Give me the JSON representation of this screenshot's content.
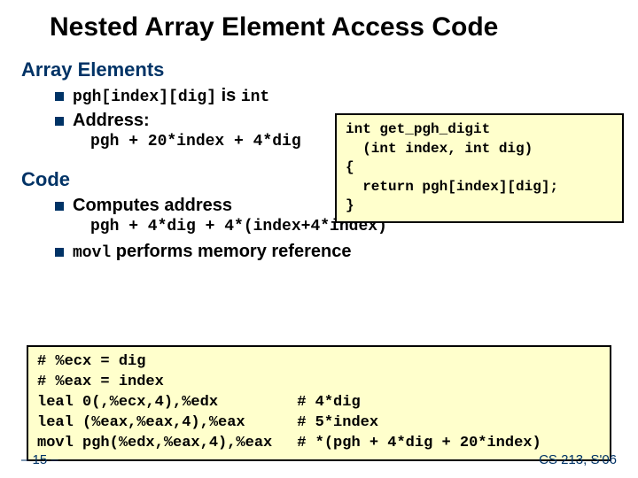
{
  "title": "Nested Array Element Access Code",
  "section1": "Array Elements",
  "b1a": "pgh[index][dig]",
  "b1b": " is ",
  "b1c": "int",
  "b2": "Address:",
  "addr_expr": "pgh + 20*index + 4*dig",
  "section2": "Code",
  "b3": "Computes address",
  "comp_expr": "pgh + 4*dig + 4*(index+4*index)",
  "b4a": "movl",
  "b4b": " performs memory reference",
  "code_get": "int get_pgh_digit\n  (int index, int dig)\n{\n  return pgh[index][dig];\n}",
  "asm_left": "# %ecx = dig\n# %eax = index\nleal 0(,%ecx,4),%edx\nleal (%eax,%eax,4),%eax\nmovl pgh(%edx,%eax,4),%eax",
  "asm_right": "\n\n# 4*dig\n# 5*index\n# *(pgh + 4*dig + 20*index)",
  "footer_left": "– 15 –",
  "footer_right": "CS 213, S'06"
}
